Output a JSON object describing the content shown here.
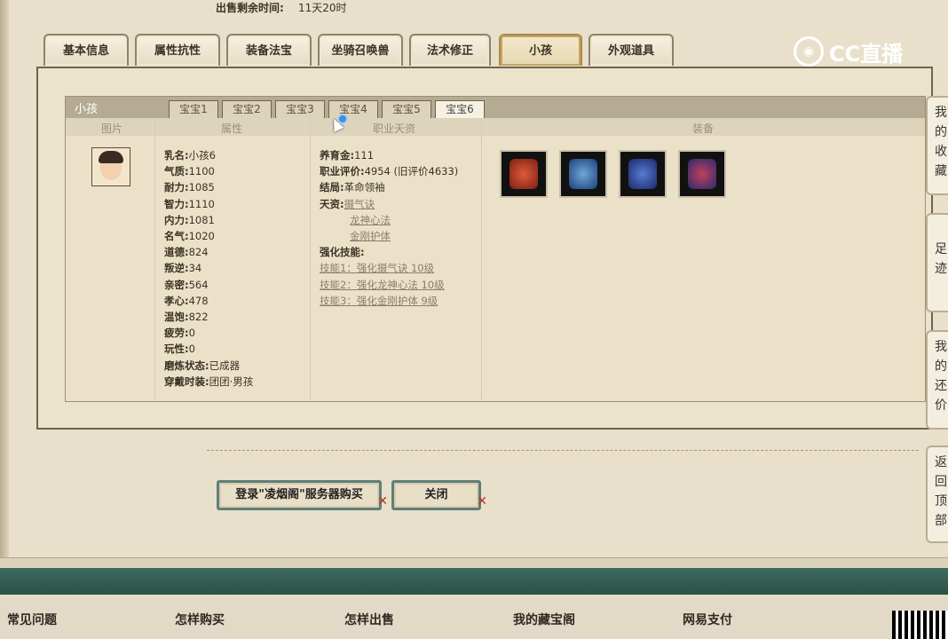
{
  "sale_time": {
    "label": "出售剩余时间:",
    "value": "11天20时"
  },
  "tabs": [
    {
      "label": "基本信息"
    },
    {
      "label": "属性抗性"
    },
    {
      "label": "装备法宝"
    },
    {
      "label": "坐骑召唤兽"
    },
    {
      "label": "法术修正"
    },
    {
      "label": "小孩"
    },
    {
      "label": "外观道具"
    }
  ],
  "logo": {
    "text": "CC直播"
  },
  "child_panel": {
    "title": "小孩",
    "subtabs": [
      "宝宝1",
      "宝宝2",
      "宝宝3",
      "宝宝4",
      "宝宝5",
      "宝宝6"
    ],
    "active_subtab": "宝宝6",
    "columns": [
      "图片",
      "属性",
      "职业天资",
      "装备"
    ],
    "attributes": [
      {
        "k": "乳名:",
        "v": "小孩6"
      },
      {
        "k": "气质:",
        "v": "1100"
      },
      {
        "k": "耐力:",
        "v": "1085"
      },
      {
        "k": "智力:",
        "v": "1110"
      },
      {
        "k": "内力:",
        "v": "1081"
      },
      {
        "k": "名气:",
        "v": "1020"
      },
      {
        "k": "道德:",
        "v": "824"
      },
      {
        "k": "叛逆:",
        "v": "34"
      },
      {
        "k": "亲密:",
        "v": "564"
      },
      {
        "k": "孝心:",
        "v": "478"
      },
      {
        "k": "温饱:",
        "v": "822"
      },
      {
        "k": "疲劳:",
        "v": "0"
      },
      {
        "k": "玩性:",
        "v": "0"
      },
      {
        "k": "磨炼状态:",
        "v": "已成器"
      },
      {
        "k": "穿戴时装:",
        "v": "团团·男孩"
      }
    ],
    "career": {
      "money": {
        "k": "养育金:",
        "v": "111"
      },
      "rating": {
        "k": "职业评价:",
        "v": "4954 (旧评价4633)"
      },
      "ending": {
        "k": "结局:",
        "v": "革命领袖"
      },
      "talent_label": "天资:",
      "talents": [
        "摄气诀",
        "龙神心法",
        "金刚护体"
      ],
      "skills_label": "强化技能:",
      "skills": [
        "技能1：强化摄气诀 10级",
        "技能2：强化龙神心法 10级",
        "技能3：强化金刚护体 9级"
      ]
    },
    "equipment": [
      {
        "icon": "red-armor-icon",
        "color": "#b3382a"
      },
      {
        "icon": "blue-robe-icon",
        "color": "#3f63a8"
      },
      {
        "icon": "blue-cloth-icon",
        "color": "#2e4c9a"
      },
      {
        "icon": "armor-set-icon",
        "color": "#5a3e8a"
      }
    ]
  },
  "buttons": {
    "buy": "登录\"凌烟阁\"服务器购买",
    "close": "关闭"
  },
  "side_nav": [
    {
      "label": "我的收藏"
    },
    {
      "label": "足迹"
    },
    {
      "label": "我的还价"
    },
    {
      "label": "返回顶部"
    }
  ],
  "footer": [
    "常见问题",
    "怎样购买",
    "怎样出售",
    "我的藏宝阁",
    "网易支付"
  ]
}
